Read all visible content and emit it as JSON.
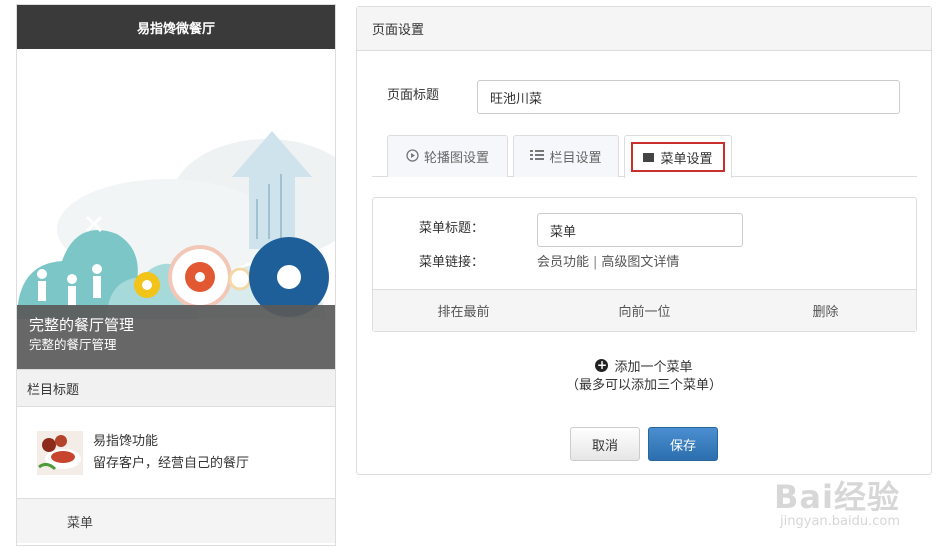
{
  "phone": {
    "header_title": "易指馋微餐厅",
    "banner": {
      "caption_title": "完整的餐厅管理",
      "caption_subtitle": "完整的餐厅管理"
    },
    "column_title": "栏目标题",
    "feature": {
      "title": "易指馋功能",
      "desc": "留存客户，经营自己的餐厅"
    },
    "menu_label": "菜单"
  },
  "panel": {
    "title": "页面设置",
    "page_title_label": "页面标题",
    "page_title_value": "旺池川菜",
    "tabs": [
      {
        "label": "轮播图设置",
        "icon": "play-circle-icon"
      },
      {
        "label": "栏目设置",
        "icon": "list-icon"
      },
      {
        "label": "菜单设置",
        "icon": "square-icon",
        "active": true
      }
    ],
    "menu_item": {
      "title_label": "菜单标题：",
      "title_value": "菜单",
      "link_label": "菜单链接：",
      "link_options": [
        "会员功能",
        "高级图文详情"
      ],
      "link_separator": "|",
      "actions": [
        "排在最前",
        "向前一位",
        "删除"
      ]
    },
    "add_menu": {
      "label": "添加一个菜单",
      "hint": "（最多可以添加三个菜单）"
    },
    "buttons": {
      "cancel": "取消",
      "save": "保存"
    }
  },
  "watermark": {
    "brand": "Bai经验",
    "url": "jingyan.baidu.com"
  },
  "colors": {
    "save_button": "#2c6eae",
    "active_tab_highlight": "#c9302c",
    "phone_header": "#3a3a3a"
  }
}
